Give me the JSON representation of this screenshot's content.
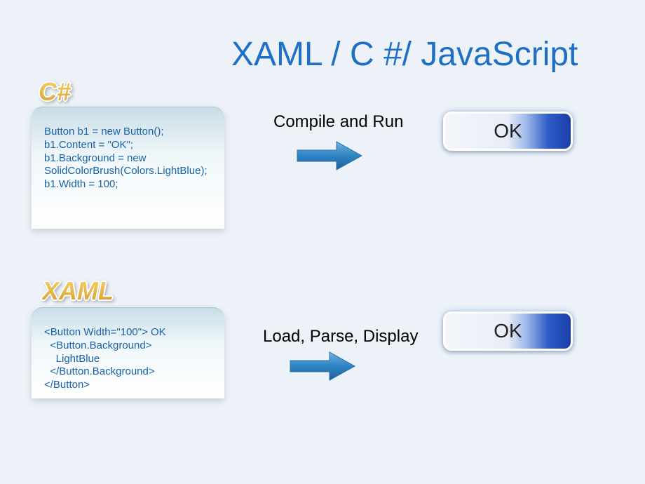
{
  "title": "XAML / C #/ JavaScript",
  "sections": {
    "csharp": {
      "label": "C#",
      "code": "Button b1 = new Button();\nb1.Content = \"OK\";\nb1.Background = new\nSolidColorBrush(Colors.LightBlue);\nb1.Width = 100;",
      "flow": "Compile and Run",
      "button_text": "OK"
    },
    "xaml": {
      "label": "XAML",
      "code": "<Button Width=\"100\"> OK\n  <Button.Background>\n    LightBlue\n  </Button.Background>\n</Button>",
      "flow": "Load, Parse, Display",
      "button_text": "OK"
    }
  }
}
